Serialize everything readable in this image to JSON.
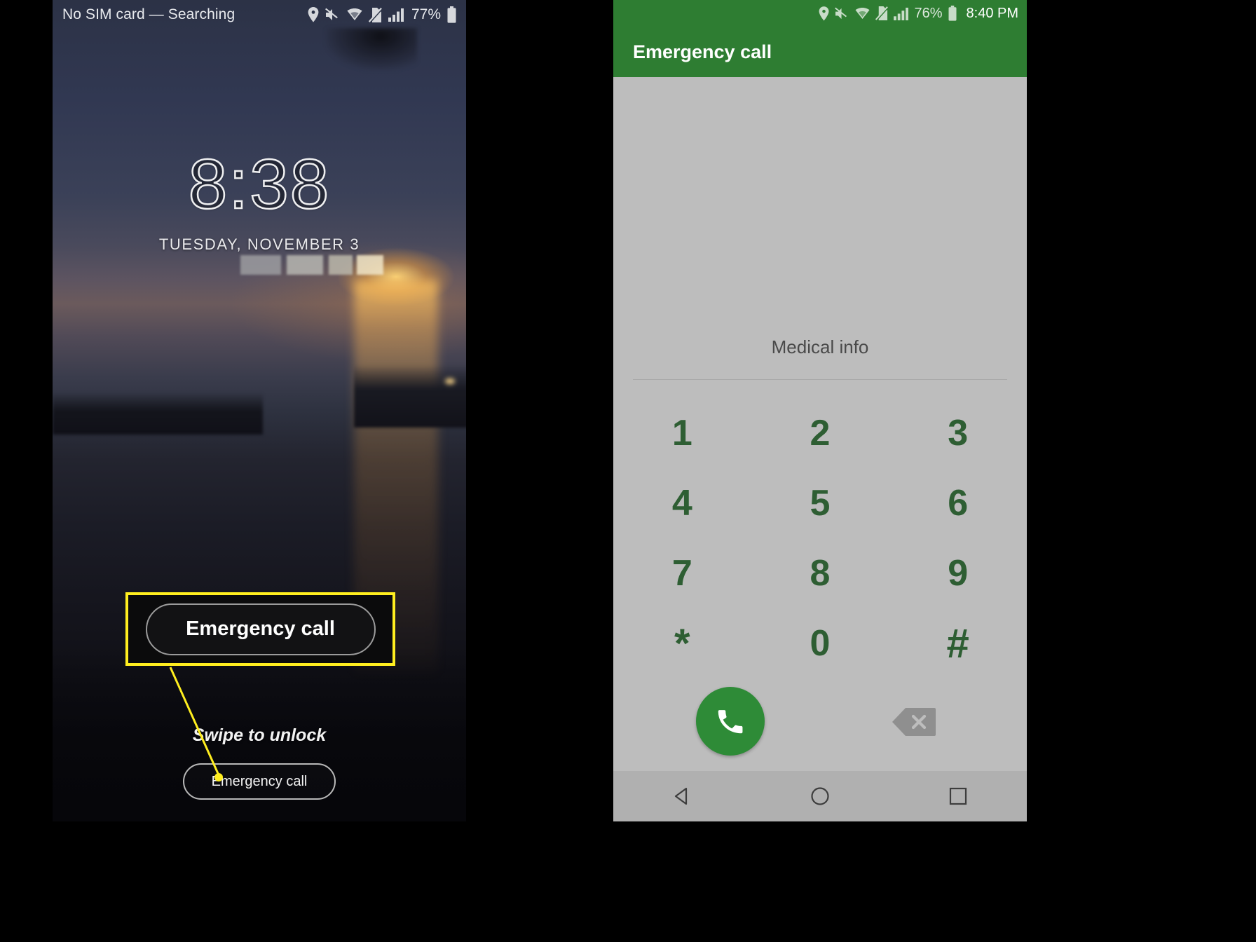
{
  "left_phone": {
    "status_bar": {
      "carrier_text": "No SIM card — Searching",
      "battery_percent": "77%",
      "icons": [
        "location-icon",
        "mute-icon",
        "wifi-icon",
        "no-sim-icon",
        "signal-icon",
        "battery-icon"
      ]
    },
    "lock_screen": {
      "clock": "8:38",
      "date": "TUESDAY, NOVEMBER 3",
      "redacted_line": "",
      "swipe_hint": "Swipe to unlock",
      "emergency_button_label": "Emergency call"
    },
    "callout": {
      "button_label": "Emergency call",
      "highlight_color": "#ffee1f",
      "box_background": "#0b0b0c"
    }
  },
  "right_phone": {
    "status_bar": {
      "time": "8:40 PM",
      "battery_percent": "76%",
      "background_color": "#2e7d32",
      "icons": [
        "location-icon",
        "mute-icon",
        "wifi-icon",
        "no-sim-icon",
        "signal-icon",
        "battery-icon"
      ]
    },
    "app_bar": {
      "title": "Emergency call",
      "background_color": "#2e7d32"
    },
    "dialer": {
      "medical_info_label": "Medical info",
      "keys": [
        "1",
        "2",
        "3",
        "4",
        "5",
        "6",
        "7",
        "8",
        "9",
        "*",
        "0",
        "#"
      ],
      "key_color": "#2e5e33",
      "background_color": "#bdbdbd",
      "call_button": {
        "icon": "phone-icon",
        "color": "#2e8b37"
      },
      "backspace_button": {
        "icon": "backspace-icon"
      }
    },
    "nav_bar": {
      "buttons": [
        "back-icon",
        "home-icon",
        "recents-icon"
      ]
    }
  }
}
